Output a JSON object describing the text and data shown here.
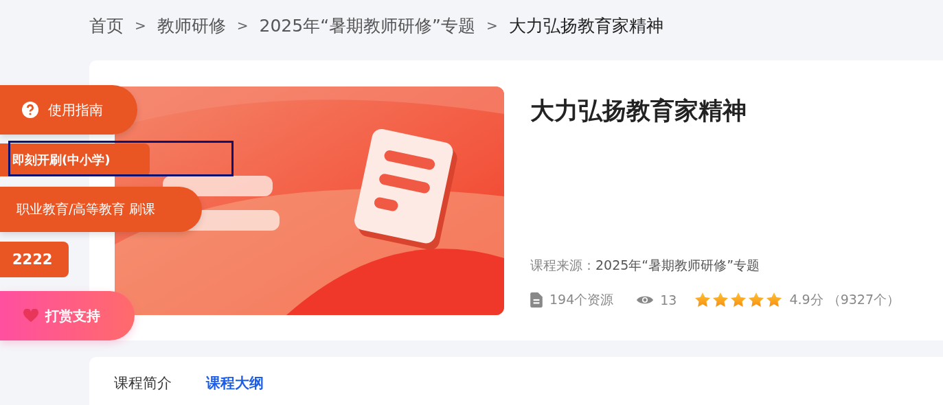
{
  "breadcrumb": [
    {
      "label": "首页"
    },
    {
      "label": "教师研修"
    },
    {
      "label": "2025年“暑期教师研修”专题"
    },
    {
      "label": "大力弘扬教育家精神"
    }
  ],
  "breadcrumb_separator": ">",
  "course": {
    "title": "大力弘扬教育家精神",
    "source_label": "课程来源：",
    "source": "2025年“暑期教师研修”专题",
    "resources": "194个资源",
    "views": "13",
    "stars": 5,
    "score": "4.9分",
    "count": "（9327个）"
  },
  "float_buttons": [
    {
      "kind": "guide",
      "label": "使用指南"
    },
    {
      "kind": "start",
      "label": "即刻开刷(中小学)",
      "highlighted": true
    },
    {
      "kind": "pill",
      "label": "职业教育/高等教育 刷课"
    },
    {
      "kind": "square",
      "label": "2222"
    },
    {
      "kind": "donate",
      "label": "打赏支持"
    }
  ],
  "tabs": [
    {
      "label": "课程简介",
      "selected": false
    },
    {
      "label": "课程大纲",
      "selected": true
    }
  ]
}
